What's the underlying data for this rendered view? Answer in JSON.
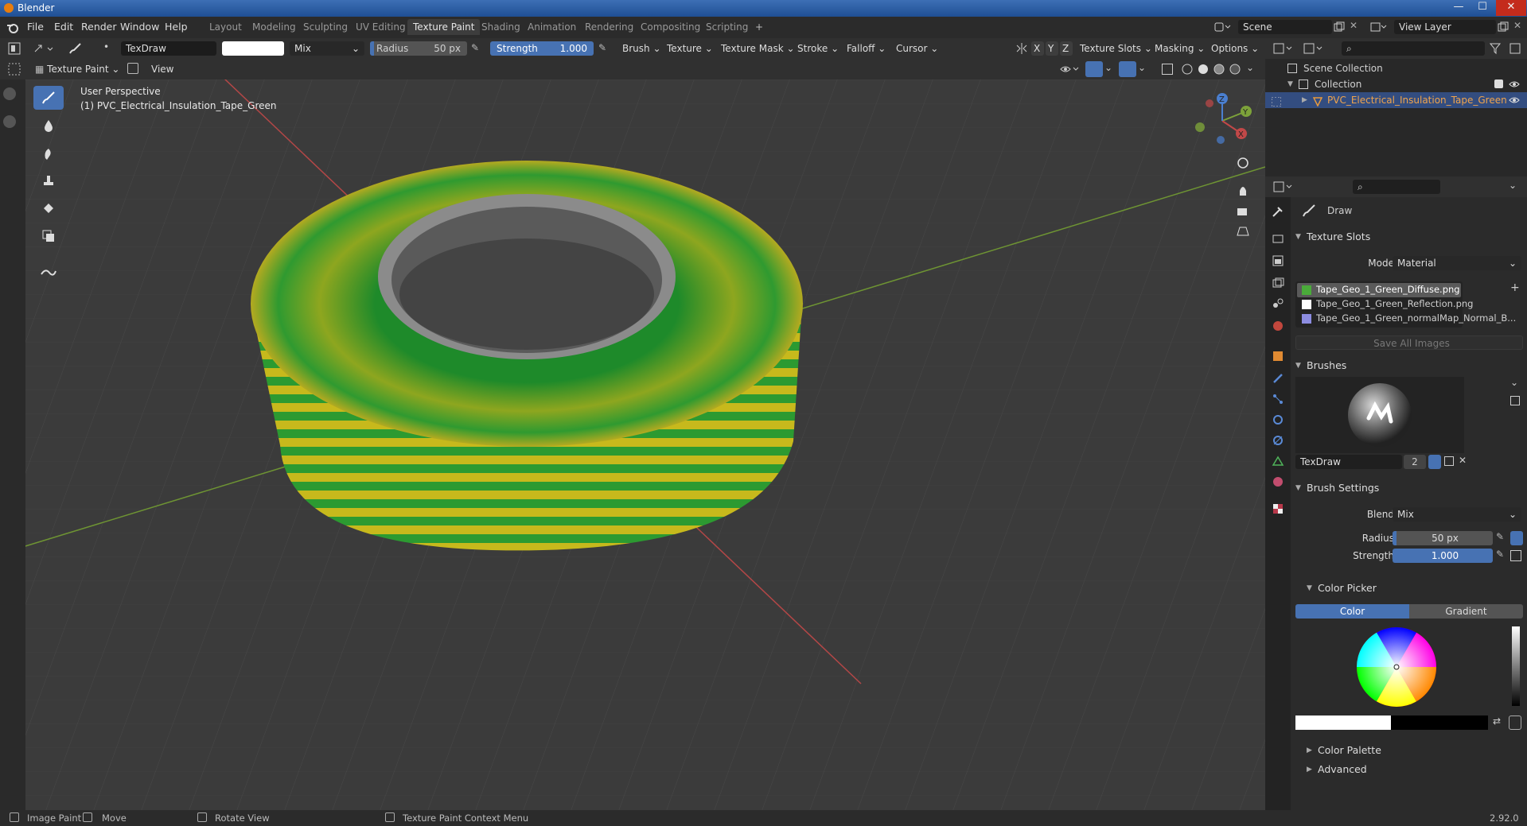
{
  "window": {
    "title": "Blender",
    "minimize": "—",
    "maximize": "☐",
    "close": "✕"
  },
  "menu": [
    "File",
    "Edit",
    "Render",
    "Window",
    "Help"
  ],
  "workspaces": [
    "Layout",
    "Modeling",
    "Sculpting",
    "UV Editing",
    "Texture Paint",
    "Shading",
    "Animation",
    "Rendering",
    "Compositing",
    "Scripting",
    "+"
  ],
  "scene": {
    "name": "Scene",
    "view_layer": "View Layer"
  },
  "toolheader": {
    "brush_name": "TexDraw",
    "blend": "Mix",
    "radius_label": "Radius",
    "radius_value": "50 px",
    "strength_label": "Strength",
    "strength_value": "1.000",
    "menus": [
      "Brush",
      "Texture",
      "Texture Mask",
      "Stroke",
      "Falloff",
      "Cursor"
    ],
    "axes": [
      "X",
      "Y",
      "Z"
    ],
    "right_menus": [
      "Texture Slots",
      "Masking",
      "Options"
    ]
  },
  "subheader": {
    "mode": "Texture Paint",
    "view": "View"
  },
  "viewport": {
    "perspective": "User Perspective",
    "object": "(1) PVC_Electrical_Insulation_Tape_Green",
    "gizmo": {
      "x": "X",
      "y": "Y",
      "z": "Z"
    }
  },
  "outliner": {
    "scene_collection": "Scene Collection",
    "collection": "Collection",
    "object": "PVC_Electrical_Insulation_Tape_Green"
  },
  "properties": {
    "brush_header": "Draw",
    "texture_slots": {
      "title": "Texture Slots",
      "mode_label": "Mode",
      "mode_value": "Material",
      "slots": [
        "Tape_Geo_1_Green_Diffuse.png",
        "Tape_Geo_1_Green_Reflection.png",
        "Tape_Geo_1_Green_normalMap_Normal_B..."
      ],
      "save_all": "Save All Images"
    },
    "brushes": {
      "title": "Brushes",
      "name": "TexDraw",
      "users": "2"
    },
    "brush_settings": {
      "title": "Brush Settings",
      "blend_label": "Blend",
      "blend_value": "Mix",
      "radius_label": "Radius",
      "radius_value": "50 px",
      "strength_label": "Strength",
      "strength_value": "1.000"
    },
    "color_picker": {
      "title": "Color Picker",
      "tab_color": "Color",
      "tab_gradient": "Gradient"
    },
    "color_palette": "Color Palette",
    "advanced": "Advanced"
  },
  "statusbar": {
    "image_paint": "Image Paint",
    "move": "Move",
    "rotate": "Rotate View",
    "context": "Texture Paint Context Menu",
    "version": "2.92.0"
  },
  "colors": {
    "accent": "#4772b3",
    "tape_green": "#1f8a2a",
    "tape_yellow": "#c9b51a",
    "x_axis": "#c24848",
    "y_axis": "#7da23a"
  }
}
